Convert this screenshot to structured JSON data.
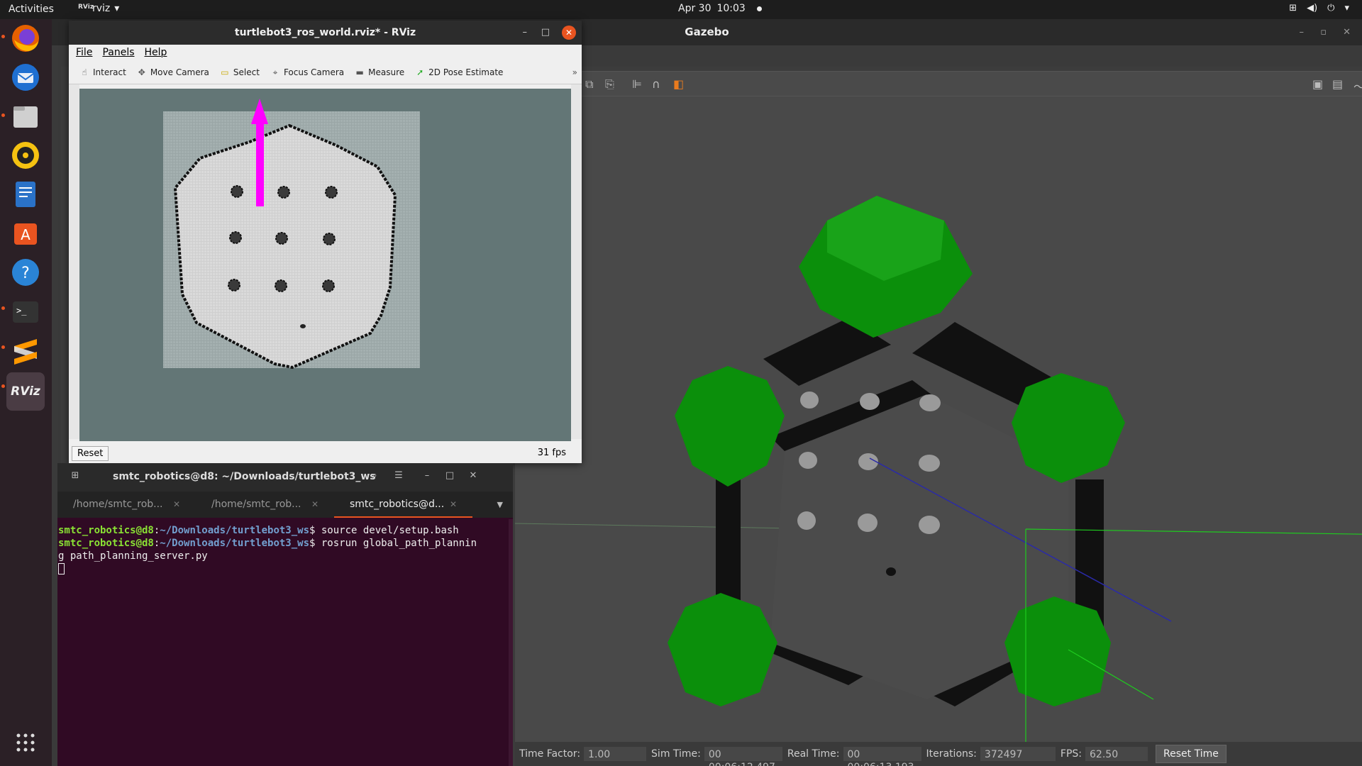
{
  "topbar": {
    "activities": "Activities",
    "app_name": "rviz",
    "app_icon_label": "RViz",
    "date": "Apr 30",
    "time": "10:03"
  },
  "dock": {
    "items": [
      {
        "name": "firefox",
        "color": "#e66000"
      },
      {
        "name": "thunderbird",
        "color": "#1f6fd1"
      },
      {
        "name": "files",
        "color": "#c0c0c0"
      },
      {
        "name": "rhythmbox",
        "color": "#f5c211"
      },
      {
        "name": "libreoffice-writer",
        "color": "#2a72c8"
      },
      {
        "name": "ubuntu-software",
        "color": "#e95420"
      },
      {
        "name": "help",
        "color": "#2a84d6"
      },
      {
        "name": "terminal",
        "color": "#333333"
      },
      {
        "name": "sublime",
        "color": "#ff9800"
      },
      {
        "name": "rviz",
        "color": "#3a3a3a"
      }
    ],
    "rviz_label": "RViz"
  },
  "gazebo": {
    "title": "Gazebo",
    "bottom": {
      "time_factor_label": "Time Factor:",
      "time_factor": "1.00",
      "sim_time_label": "Sim Time:",
      "sim_time": "00 00:06:12.497",
      "real_time_label": "Real Time:",
      "real_time": "00 00:06:13.193",
      "iterations_label": "Iterations:",
      "iterations": "372497",
      "fps_label": "FPS:",
      "fps": "62.50",
      "reset_time": "Reset Time"
    },
    "colors": {
      "green": "#0b8f0b",
      "wall": "#111111",
      "floor": "#494949",
      "cylinder": "#9a9a9a"
    }
  },
  "rviz": {
    "title": "turtlebot3_ros_world.rviz* - RViz",
    "menu": {
      "file": "File",
      "panels": "Panels",
      "help": "Help"
    },
    "tools": {
      "interact": "Interact",
      "move_camera": "Move Camera",
      "select": "Select",
      "focus_camera": "Focus Camera",
      "measure": "Measure",
      "pose_estimate": "2D Pose Estimate"
    },
    "reset": "Reset",
    "fps": "31 fps",
    "colors": {
      "background": "#637676",
      "arrow": "#ff00ff",
      "map_free": "#d9d9d9",
      "map_unknown": "#9aa6a6"
    }
  },
  "terminal": {
    "title": "smtc_robotics@d8: ~/Downloads/turtlebot3_ws",
    "tabs": [
      "/home/smtc_rob...",
      "/home/smtc_rob...",
      "smtc_robotics@d..."
    ],
    "lines": [
      {
        "user": "smtc_robotics@d8",
        "sep": ":",
        "path": "~/Downloads/turtlebot3_ws",
        "cmd": "$ source devel/setup.bash"
      },
      {
        "user": "smtc_robotics@d8",
        "sep": ":",
        "path": "~/Downloads/turtlebot3_ws",
        "cmd": "$ rosrun global_path_plannin"
      }
    ],
    "wrap": "g path_planning_server.py"
  }
}
